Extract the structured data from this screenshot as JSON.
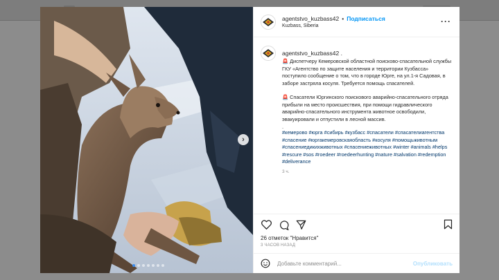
{
  "post": {
    "username": "agentstvo_kuzbass42",
    "separator": "•",
    "follow_label": "Подписаться",
    "location": "Kuzbass, Siberia",
    "more_icon": "more-horizontal-icon"
  },
  "caption": {
    "username": "agentstvo_kuzbass42",
    "username_suffix": ".",
    "paragraph1": "🚨 Диспетчеру Кемеровской областной поисково-спасательной службы ГКУ «Агентство по защите населения и территории Кузбасса» поступило сообщение о том, что в городе Юрге, на ул.1-я Садовая, в заборе застряла косуля. Требуется помощь спасателей.",
    "paragraph2": "🚨 Спасатели Юргинского поискового аварийно-спасательного отряда прибыли на место происшествия, при помощи гидравлического аварийно-спасательного инструмента животное освободили, эвакуировали и отпустили в лесной массив.",
    "dot_line": ".",
    "hashtags": "#кемерово #юрга #сибирь #кузбасс #спасатели #спасателиагентства #спасение #юргакемеровскаяобласть #косуля #помощьживотным #спасениедикихживотных #спасениеживотных #winter #animals #helps #rescure #sos #roedeer #roedeerhunting #nature #salvation #redemption #deliverance",
    "time_ago": "3 ч."
  },
  "actions": {
    "like_icon": "heart-icon",
    "comment_icon": "comment-icon",
    "share_icon": "share-icon",
    "save_icon": "bookmark-icon"
  },
  "likes_text": "26 отметок \"Нравится\"",
  "posted_ago": "3 ЧАСОВ НАЗАД",
  "comment": {
    "placeholder": "Добавьте комментарий...",
    "publish_label": "Опубликовать",
    "emoji_icon": "emoji-icon"
  },
  "carousel": {
    "next_icon": "chevron-right-icon",
    "dot_count": 7,
    "active_index": 0
  },
  "colors": {
    "accent": "#0095f6",
    "hashtag": "#00376b",
    "muted": "#8e8e8e",
    "publish_disabled": "#b2dffc"
  }
}
